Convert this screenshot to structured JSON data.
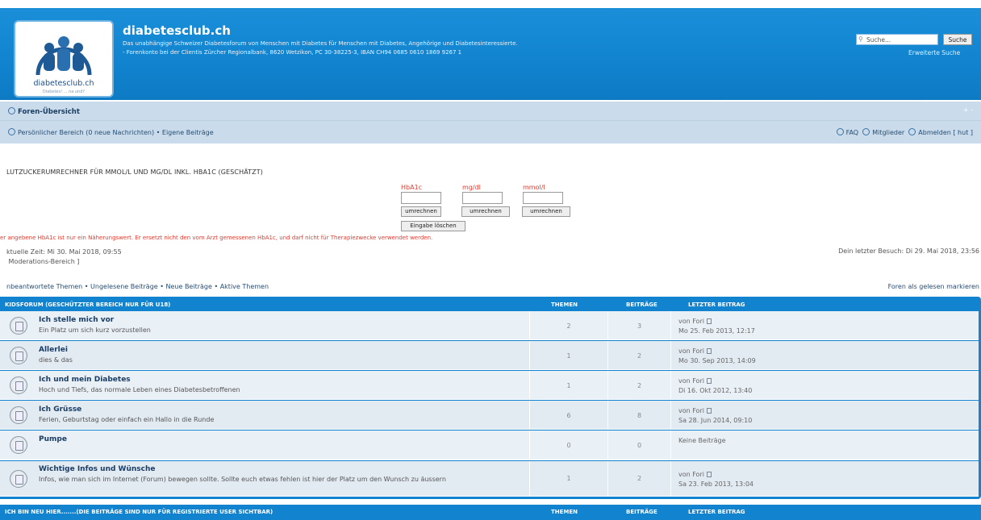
{
  "header": {
    "title": "diabetesclub.ch",
    "description_line1": "Das unabhängige Schweizer Diabetesforum von Menschen mit Diabetes für Menschen mit Diabetes, Angehörige und Diabetesinteressierte.",
    "description_line2": "- Forenkonto bei der Clientis Zürcher Regionalbank, 8620 Wetzikon, PC 30-38225-3, IBAN CH94 0685 0610 1869 9267 1",
    "logo_text": "diabetesclub.ch",
    "logo_tagline": "Diabetes! ... na und?",
    "search_placeholder": "Suche...",
    "search_button": "Suche",
    "advanced_search": "Erweiterte Suche"
  },
  "nav": {
    "forum_overview": "Foren-Übersicht",
    "right_small": "+ -",
    "personal_area": "Persönlicher Bereich (0 neue Nachrichten) • Eigene Beiträge",
    "faq": "FAQ",
    "members": "Mitglieder",
    "logout": "Abmelden [ hut ]"
  },
  "calculator": {
    "title": "LUTZUCKERUMRECHNER FÜR MMOL/L UND MG/DL INKL. HBA1C (GESCHÄTZT)",
    "labels": [
      "HbA1c",
      "mg/dl",
      "mmol/l"
    ],
    "convert": "umrechnen",
    "clear": "Eingabe löschen",
    "warning": "er angebene HbA1c ist nur ein Näherungswert. Er ersetzt nicht den vom Arzt gemessenen HbA1c, und darf nicht für Therapiezwecke verwendet werden."
  },
  "info": {
    "current_time": "ktuelle Zeit: Mi 30. Mai 2018, 09:55",
    "moderation": "Moderations-Bereich ]",
    "last_visit": "Dein letzter Besuch: Di 29. Mai 2018, 23:56",
    "links": "nbeantwortete Themen • Ungelesene Beiträge • Neue Beiträge • Aktive Themen",
    "mark_read": "Foren als gelesen markieren"
  },
  "forum": {
    "header": "KIDSFORUM (GESCHÜTZTER BEREICH NUR FÜR U18)",
    "col_topics": "THEMEN",
    "col_posts": "BEITRÄGE",
    "col_last": "LETZTER BEITRAG",
    "rows": [
      {
        "title": "Ich stelle mich vor",
        "desc": "Ein Platz um sich kurz vorzustellen",
        "topics": "2",
        "posts": "3",
        "last_by": "von Fori",
        "last_date": "Mo 25. Feb 2013, 12:17"
      },
      {
        "title": "Allerlei",
        "desc": "dies & das",
        "topics": "1",
        "posts": "2",
        "last_by": "von Fori",
        "last_date": "Mo 30. Sep 2013, 14:09"
      },
      {
        "title": "Ich und mein Diabetes",
        "desc": "Hoch und Tiefs, das normale Leben eines Diabetesbetroffenen",
        "topics": "1",
        "posts": "2",
        "last_by": "von Fori",
        "last_date": "Di 16. Okt 2012, 13:40"
      },
      {
        "title": "Ich Grüsse",
        "desc": "Ferien, Geburtstag oder einfach ein Hallo in die Runde",
        "topics": "6",
        "posts": "8",
        "last_by": "von Fori",
        "last_date": "Sa 28. Jun 2014, 09:10"
      },
      {
        "title": "Pumpe",
        "desc": "",
        "topics": "0",
        "posts": "0",
        "last_by": "Keine Beiträge",
        "last_date": ""
      },
      {
        "title": "Wichtige Infos und Wünsche",
        "desc": "Infos, wie man sich im Internet (Forum) bewegen sollte. Sollte euch etwas fehlen ist hier der Platz um den Wunsch zu äussern",
        "topics": "1",
        "posts": "2",
        "last_by": "von Fori",
        "last_date": "Sa 23. Feb 2013, 13:04"
      }
    ]
  },
  "forum2": {
    "header": "ICH BIN NEU HIER.......(DIE BEITRÄGE SIND NUR FÜR REGISTRIERTE USER SICHTBAR)",
    "col_topics": "THEMEN",
    "col_posts": "BEITRÄGE",
    "col_last": "LETZTER BEITRAG"
  }
}
